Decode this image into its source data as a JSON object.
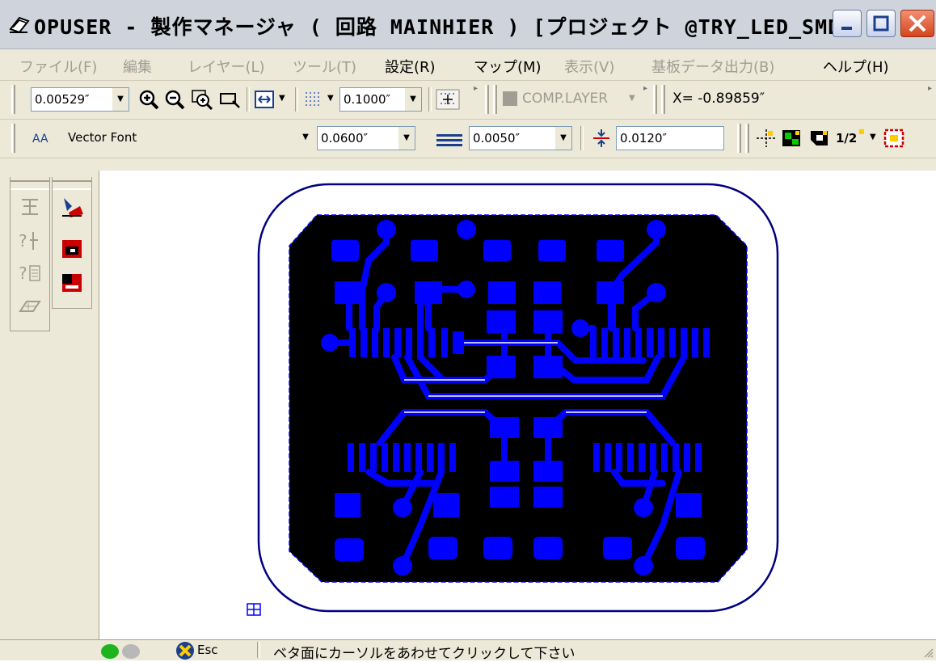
{
  "window": {
    "title": "OPUSER - 製作マネージャ ( 回路 MAINHIER ) [プロジェクト @TRY_LED_SMD]"
  },
  "menu": [
    {
      "label": "ファイル(F)",
      "enabled": false
    },
    {
      "label": "編集",
      "enabled": false
    },
    {
      "label": "レイヤー(L)",
      "enabled": false
    },
    {
      "label": "ツール(T)",
      "enabled": false
    },
    {
      "label": "設定(R)",
      "enabled": true
    },
    {
      "label": "マップ(M)",
      "enabled": true
    },
    {
      "label": "表示(V)",
      "enabled": false
    },
    {
      "label": "基板データ出力(B)",
      "enabled": false
    },
    {
      "label": "ヘルプ(H)",
      "enabled": true
    }
  ],
  "toolbar1": {
    "zoom_value": "0.00529″",
    "grid_value": "0.1000″",
    "layer": "COMP.LAYER",
    "coord_x": "X= -0.89859″"
  },
  "toolbar2": {
    "font_label": "Vector Font",
    "text_size": "0.0600″",
    "line_width": "0.0050″",
    "clearance": "0.0120″",
    "half_label": "1/2"
  },
  "statusbar": {
    "esc_label": "Esc",
    "message": "ベタ面にカーソルをあわせてクリックして下さい"
  },
  "colors": {
    "copper": "#0000ff",
    "fill": "#000000",
    "board_outline": "#000080"
  }
}
